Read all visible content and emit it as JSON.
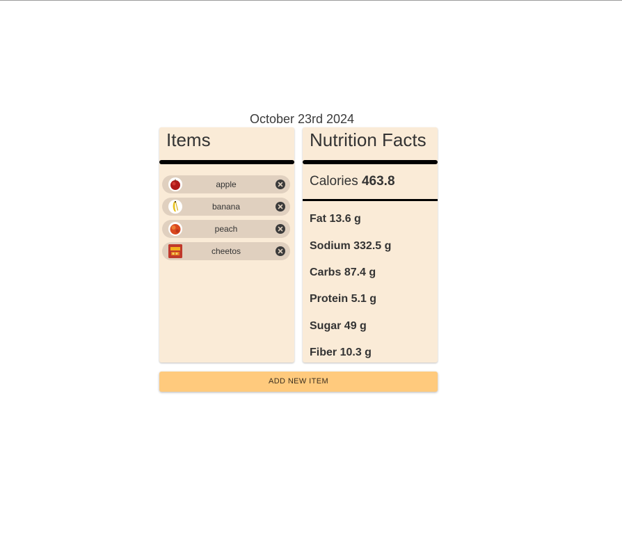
{
  "date": "October 23rd 2024",
  "items_panel": {
    "title": "Items",
    "items": [
      {
        "label": "apple",
        "icon": "apple-icon"
      },
      {
        "label": "banana",
        "icon": "banana-icon"
      },
      {
        "label": "peach",
        "icon": "peach-icon"
      },
      {
        "label": "cheetos",
        "icon": "cheetos-icon"
      }
    ]
  },
  "nutrition_panel": {
    "title": "Nutrition Facts",
    "calories_label": "Calories",
    "calories_value": "463.8",
    "nutrients": [
      {
        "label": "Fat",
        "value": "13.6 g"
      },
      {
        "label": "Sodium",
        "value": "332.5 g"
      },
      {
        "label": "Carbs",
        "value": "87.4 g"
      },
      {
        "label": "Protein",
        "value": "5.1 g"
      },
      {
        "label": "Sugar",
        "value": "49 g"
      },
      {
        "label": "Fiber",
        "value": "10.3 g"
      }
    ]
  },
  "add_button_label": "ADD NEW ITEM",
  "colors": {
    "panel_bg": "#faebd7",
    "chip_bg": "#e0d0bf",
    "button_bg": "#ffca7d"
  }
}
